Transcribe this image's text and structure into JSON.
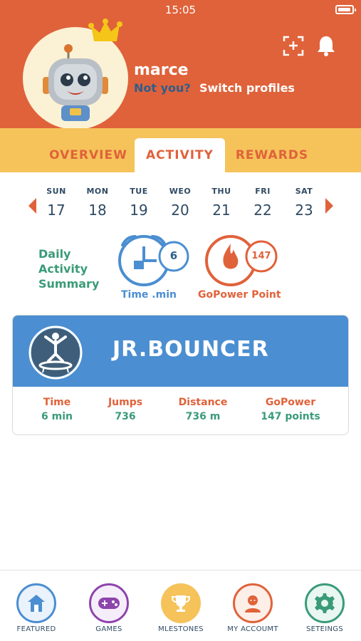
{
  "status_bar": {
    "time": "15:05"
  },
  "profile": {
    "username": "marce",
    "not_you": "Not you?",
    "switch_profiles": "Switch profiles"
  },
  "tabs": [
    {
      "label": "OVERVIEW",
      "active": false
    },
    {
      "label": "ACTIVITY",
      "active": true
    },
    {
      "label": "REWARDS",
      "active": false
    }
  ],
  "week": [
    {
      "name": "SUN",
      "date": "17"
    },
    {
      "name": "MON",
      "date": "18"
    },
    {
      "name": "TUE",
      "date": "19"
    },
    {
      "name": "WEO",
      "date": "20"
    },
    {
      "name": "THU",
      "date": "21"
    },
    {
      "name": "FRI",
      "date": "22"
    },
    {
      "name": "SAT",
      "date": "23"
    }
  ],
  "daily_summary": {
    "label_line1": "Daily",
    "label_line2": "Activity",
    "label_line3": "Summary",
    "time_value": "6",
    "time_label": "Time .min",
    "gopower_value": "147",
    "gopower_label": "GoPower Point"
  },
  "activity_card": {
    "title": "JR.BOUNCER",
    "stats": [
      {
        "label": "Time",
        "value": "6 min"
      },
      {
        "label": "Jumps",
        "value": "736"
      },
      {
        "label": "Distance",
        "value": "736 m"
      },
      {
        "label": "GoPower",
        "value": "147 points"
      }
    ]
  },
  "bottom_nav": [
    {
      "label": "FEATURED",
      "icon": "house-icon"
    },
    {
      "label": "GAMES",
      "icon": "gamepad-icon"
    },
    {
      "label": "MLESTONES",
      "icon": "trophy-icon"
    },
    {
      "label": "MY ACCOUMT",
      "icon": "person-icon"
    },
    {
      "label": "SETEINGS",
      "icon": "gear-icon"
    }
  ],
  "colors": {
    "header": "#e0623a",
    "tabs_bar": "#f5c35a",
    "card_header": "#4b8ed1",
    "accent_green": "#3a9b78",
    "accent_blue": "#4b8ed1"
  }
}
